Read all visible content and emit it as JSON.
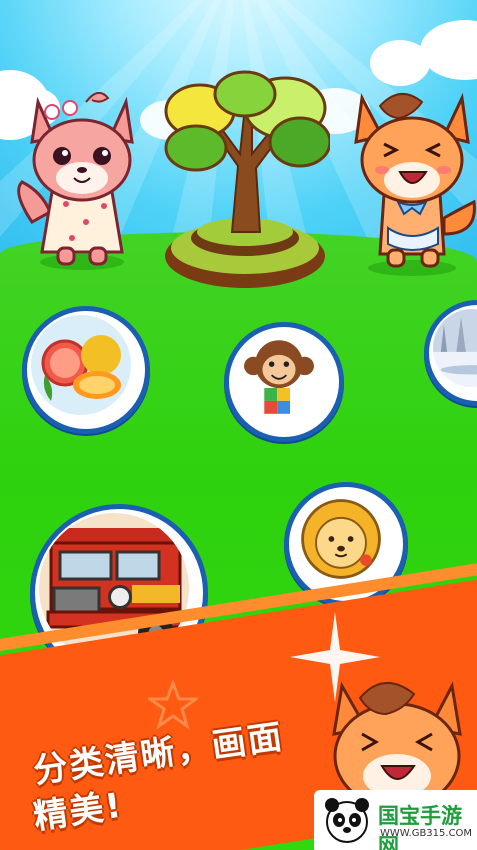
{
  "slogan": {
    "line1": "分类清晰，画面",
    "line2": "精美!"
  },
  "watermark": {
    "name": "国宝手游网",
    "url": "WWW.GB315.COM"
  },
  "categories": [
    {
      "name": "fruits-bubble",
      "icon": "fruit-icon"
    },
    {
      "name": "monkey-bubble",
      "icon": "monkey-icon"
    },
    {
      "name": "winter-scene-bubble",
      "icon": "snow-landscape-icon"
    },
    {
      "name": "fire-truck-bubble",
      "icon": "fire-truck-icon"
    },
    {
      "name": "lion-bubble",
      "icon": "lion-icon"
    }
  ],
  "colors": {
    "sky": "#36c4f0",
    "grass": "#32d80f",
    "banner": "#ff5a12",
    "bubble_border": "#1a5fb2"
  }
}
